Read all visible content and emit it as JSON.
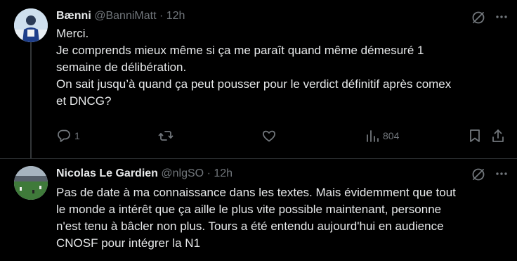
{
  "tweets": [
    {
      "name": "Bænni",
      "handle": "@BanniMatt",
      "dot": "·",
      "time": "12h",
      "lines": [
        "Merci.",
        "Je comprends mieux même si ça me paraît quand même démesuré 1",
        "semaine de délibération.",
        "On sait jusqu’à quand ça peut pousser pour le verdict définitif après comex",
        "et DNCG?"
      ],
      "actions": {
        "reply_count": "1",
        "retweet_count": "",
        "like_count": "",
        "views_count": "804"
      }
    },
    {
      "name": "Nicolas Le Gardien",
      "handle": "@nlgSO",
      "dot": "·",
      "time": "12h",
      "lines": [
        "Pas de date à ma connaissance dans les textes. Mais évidemment que tout",
        "le monde a intérêt que ça aille le plus vite possible maintenant, personne",
        "n'est tenu à bâcler non plus. Tours a été entendu aujourd'hui en audience",
        "CNOSF pour intégrer la N1"
      ]
    }
  ],
  "colors": {
    "background": "#000000",
    "text": "#e7e9ea",
    "muted": "#71767b",
    "divider": "#2f3336"
  },
  "icons": [
    "grok-icon",
    "more-icon",
    "reply-icon",
    "retweet-icon",
    "like-icon",
    "views-icon",
    "bookmark-icon",
    "share-icon"
  ]
}
